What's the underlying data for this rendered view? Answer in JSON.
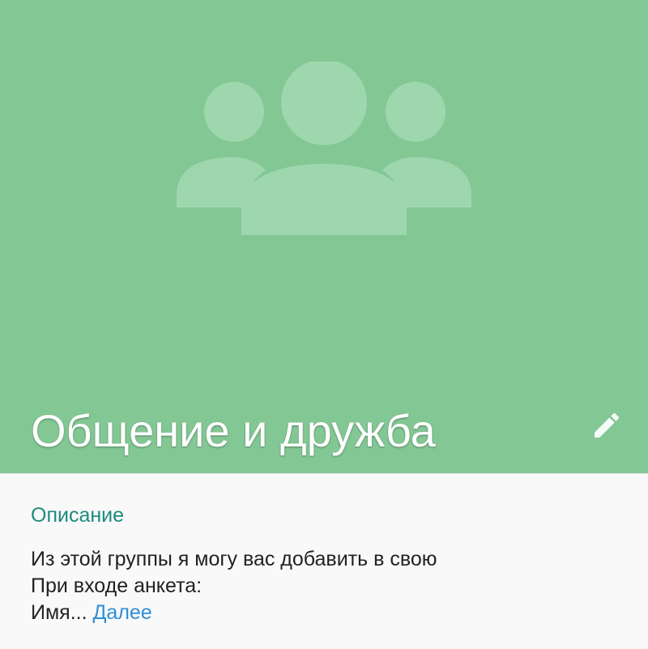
{
  "group": {
    "title": "Общение и дружба",
    "header_color": "#83c795",
    "icon": "group-people-icon",
    "edit_icon": "pencil-icon"
  },
  "description": {
    "heading": "Описание",
    "lines": [
      "Из этой группы я могу вас добавить в свою",
      "При входе анкета:",
      "Имя..."
    ],
    "more_label": "Далее",
    "accent_color": "#1d8a7e",
    "link_color": "#2f8ed8"
  }
}
